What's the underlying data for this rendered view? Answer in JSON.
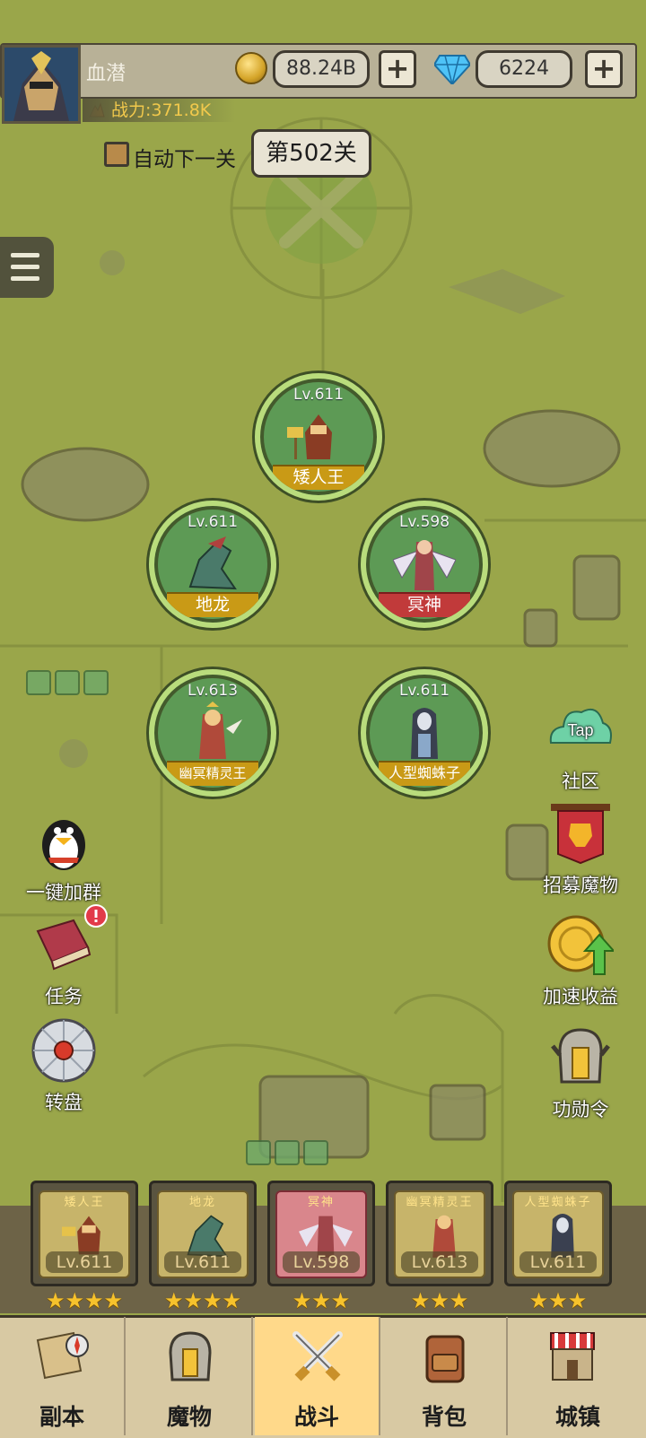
{
  "player": {
    "name": "血潜",
    "power": "战力:371.8K"
  },
  "currency": {
    "gold": "88.24B",
    "gems": "6224",
    "plus": "+"
  },
  "stage": {
    "auto_label": "自动下一关",
    "current": "第502关"
  },
  "heroes": [
    {
      "level": "Lv.611",
      "name": "矮人王"
    },
    {
      "level": "Lv.611",
      "name": "地龙"
    },
    {
      "level": "Lv.598",
      "name": "冥神"
    },
    {
      "level": "Lv.613",
      "name": "幽冥精灵王"
    },
    {
      "level": "Lv.611",
      "name": "人型蜘蛛子"
    }
  ],
  "side_left": [
    {
      "label": "一键加群",
      "icon": "penguin-icon"
    },
    {
      "label": "任务",
      "icon": "book-icon"
    },
    {
      "label": "转盘",
      "icon": "wheel-icon"
    }
  ],
  "side_right": [
    {
      "label": "社区",
      "icon": "tap-cloud-icon",
      "tap": "Tap"
    },
    {
      "label": "招募魔物",
      "icon": "banner-icon"
    },
    {
      "label": "加速收益",
      "icon": "coin-arrow-icon"
    },
    {
      "label": "功勋令",
      "icon": "helmet-icon"
    }
  ],
  "roster": [
    {
      "name": "矮人王",
      "level": "Lv.611",
      "stars": "★★★★"
    },
    {
      "name": "地龙",
      "level": "Lv.611",
      "stars": "★★★★"
    },
    {
      "name": "冥神",
      "level": "Lv.598",
      "stars": "★★★"
    },
    {
      "name": "幽冥精灵王",
      "level": "Lv.613",
      "stars": "★★★"
    },
    {
      "name": "人型蜘蛛子",
      "level": "Lv.611",
      "stars": "★★★"
    }
  ],
  "nav": [
    {
      "label": "副本"
    },
    {
      "label": "魔物"
    },
    {
      "label": "战斗"
    },
    {
      "label": "背包"
    },
    {
      "label": "城镇"
    }
  ],
  "colors": {
    "background": "#9aa64a",
    "hero_circle": "#5d9a55",
    "ribbon_gold": "#c99a16",
    "ribbon_red": "#c13a3a",
    "nav_active": "#ffd98a",
    "star": "#f6c22c"
  }
}
